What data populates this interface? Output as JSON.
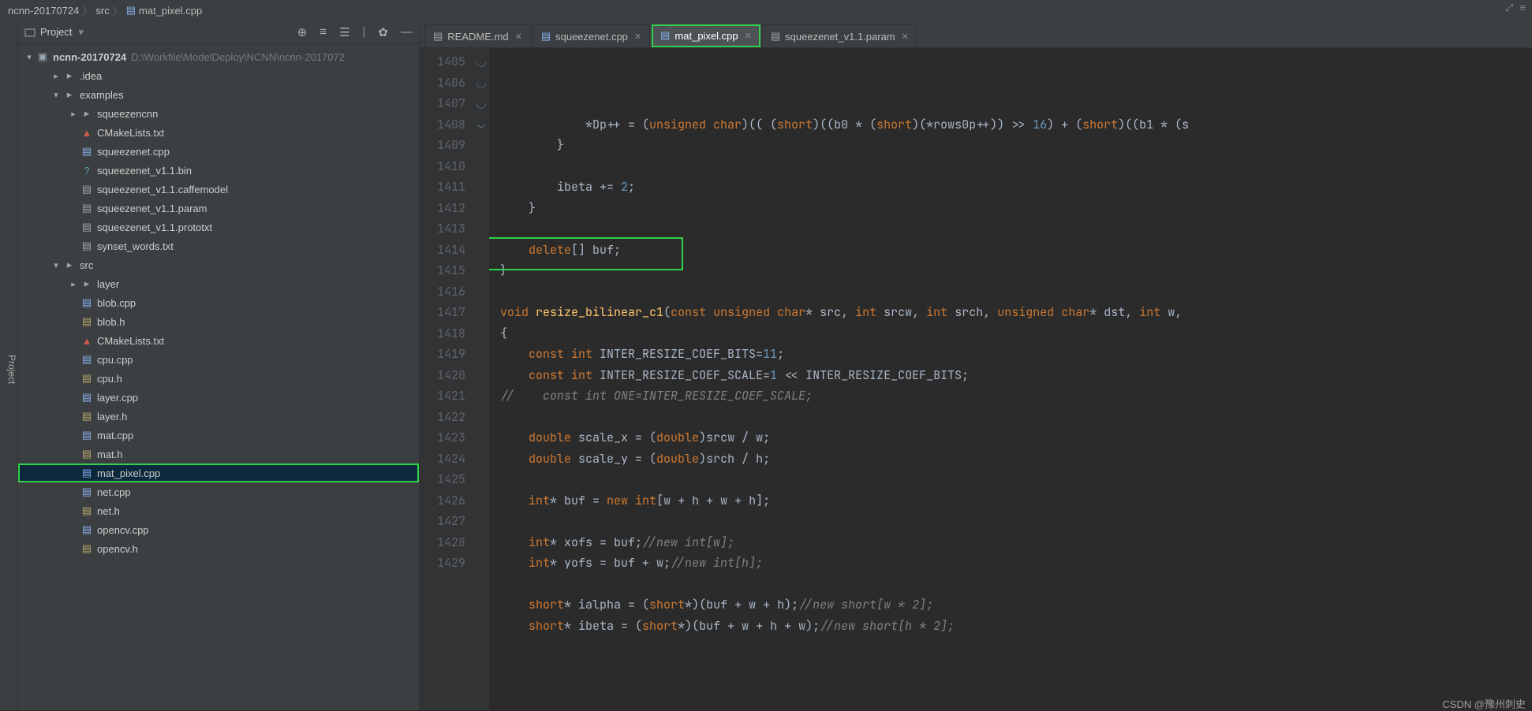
{
  "breadcrumb": {
    "root": "ncnn-20170724",
    "mid": "src",
    "file": "mat_pixel.cpp"
  },
  "sidebar_label": "Project",
  "project_header": {
    "title": "Project"
  },
  "toolbar_icons": [
    "target",
    "collapse",
    "expand",
    "settings",
    "hide"
  ],
  "tree": {
    "root_label": "ncnn-20170724",
    "root_hint": "D:\\Workfile\\ModelDeploy\\NCNN\\ncnn-2017072",
    "items": [
      {
        "depth": 1,
        "arrow": "▸",
        "icon": "folder",
        "label": ".idea"
      },
      {
        "depth": 1,
        "arrow": "▾",
        "icon": "folder",
        "label": "examples"
      },
      {
        "depth": 2,
        "arrow": "▸",
        "icon": "folder",
        "label": "squeezencnn"
      },
      {
        "depth": 2,
        "arrow": "",
        "icon": "cm",
        "label": "CMakeLists.txt"
      },
      {
        "depth": 2,
        "arrow": "",
        "icon": "cpp",
        "label": "squeezenet.cpp"
      },
      {
        "depth": 2,
        "arrow": "",
        "icon": "question",
        "label": "squeezenet_v1.1.bin"
      },
      {
        "depth": 2,
        "arrow": "",
        "icon": "txt",
        "label": "squeezenet_v1.1.caffemodel"
      },
      {
        "depth": 2,
        "arrow": "",
        "icon": "txt",
        "label": "squeezenet_v1.1.param"
      },
      {
        "depth": 2,
        "arrow": "",
        "icon": "txt",
        "label": "squeezenet_v1.1.prototxt"
      },
      {
        "depth": 2,
        "arrow": "",
        "icon": "txt",
        "label": "synset_words.txt"
      },
      {
        "depth": 1,
        "arrow": "▾",
        "icon": "folder",
        "label": "src"
      },
      {
        "depth": 2,
        "arrow": "▸",
        "icon": "folder",
        "label": "layer"
      },
      {
        "depth": 2,
        "arrow": "",
        "icon": "cpp",
        "label": "blob.cpp"
      },
      {
        "depth": 2,
        "arrow": "",
        "icon": "h",
        "label": "blob.h"
      },
      {
        "depth": 2,
        "arrow": "",
        "icon": "cm",
        "label": "CMakeLists.txt"
      },
      {
        "depth": 2,
        "arrow": "",
        "icon": "cpp",
        "label": "cpu.cpp"
      },
      {
        "depth": 2,
        "arrow": "",
        "icon": "h",
        "label": "cpu.h"
      },
      {
        "depth": 2,
        "arrow": "",
        "icon": "cpp",
        "label": "layer.cpp"
      },
      {
        "depth": 2,
        "arrow": "",
        "icon": "h",
        "label": "layer.h"
      },
      {
        "depth": 2,
        "arrow": "",
        "icon": "cpp",
        "label": "mat.cpp"
      },
      {
        "depth": 2,
        "arrow": "",
        "icon": "h",
        "label": "mat.h"
      },
      {
        "depth": 2,
        "arrow": "",
        "icon": "cpp",
        "label": "mat_pixel.cpp",
        "selected": true,
        "boxed": true
      },
      {
        "depth": 2,
        "arrow": "",
        "icon": "cpp",
        "label": "net.cpp"
      },
      {
        "depth": 2,
        "arrow": "",
        "icon": "h",
        "label": "net.h"
      },
      {
        "depth": 2,
        "arrow": "",
        "icon": "cpp",
        "label": "opencv.cpp"
      },
      {
        "depth": 2,
        "arrow": "",
        "icon": "h",
        "label": "opencv.h"
      }
    ]
  },
  "tabs": [
    {
      "icon": "md",
      "label": "README.md",
      "active": false
    },
    {
      "icon": "cpp",
      "label": "squeezenet.cpp",
      "active": false
    },
    {
      "icon": "cpp",
      "label": "mat_pixel.cpp",
      "active": true,
      "boxed": true
    },
    {
      "icon": "txt",
      "label": "squeezenet_v1.1.param",
      "active": false
    }
  ],
  "line_start": 1405,
  "code_lines": [
    "            *Dp++ = (<span class='kw'>unsigned char</span>)(( (<span class='kw'>short</span>)((b0 * (<span class='kw'>short</span>)(*rows0p++)) >> <span class='num'>16</span>) + (<span class='kw'>short</span>)((b1 * (<span class='typ'>s</span>",
    "        }",
    "",
    "        ibeta += <span class='num'>2</span>;",
    "    }",
    "",
    "    <span class='kw'>delete</span>[] buf;",
    "}",
    "",
    "<span class='kw'>void</span> <span class='fn'>resize_bilinear_c1</span>(<span class='kw'>const unsigned char</span>* src, <span class='kw'>int</span> <span class='par'>srcw</span>, <span class='kw'>int</span> <span class='par'>srch</span>, <span class='kw'>unsigned char</span>* dst, <span class='kw'>int</span> <span class='par'>w</span>,",
    "{",
    "    <span class='kw'>const int</span> INTER_RESIZE_COEF_BITS=<span class='num'>11</span>;",
    "    <span class='kw'>const int</span> INTER_RESIZE_COEF_SCALE=<span class='num'>1</span> &lt;&lt; INTER_RESIZE_COEF_BITS;",
    "<span class='cm'>//    const int ONE=INTER_RESIZE_COEF_SCALE;</span>",
    "",
    "    <span class='kw'>double</span> scale_x = (<span class='kw'>double</span>)srcw / w;",
    "    <span class='kw'>double</span> scale_y = (<span class='kw'>double</span>)srch / h;",
    "",
    "    <span class='kw'>int</span>* buf = <span class='kw'>new int</span>[w + h + w + h];",
    "",
    "    <span class='kw'>int</span>* xofs = buf;<span class='cm'>//new int[w];</span>",
    "    <span class='kw'>int</span>* yofs = buf + w;<span class='cm'>//new int[h];</span>",
    "",
    "    <span class='kw'>short</span>* ialpha = (<span class='kw'>short</span>*)(buf + w + h);<span class='cm'>//new short[w * 2];</span>",
    "    <span class='kw'>short</span>* ibeta = (<span class='kw'>short</span>*)(buf + w + h + w);<span class='cm'>//new short[h * 2];</span>"
  ],
  "fold_marks": {
    "0": "",
    "1": "◡",
    "3": "",
    "4": "◡",
    "7": "◡",
    "9": "⌄",
    "10": ""
  },
  "watermark": "CSDN @豫州刺史"
}
